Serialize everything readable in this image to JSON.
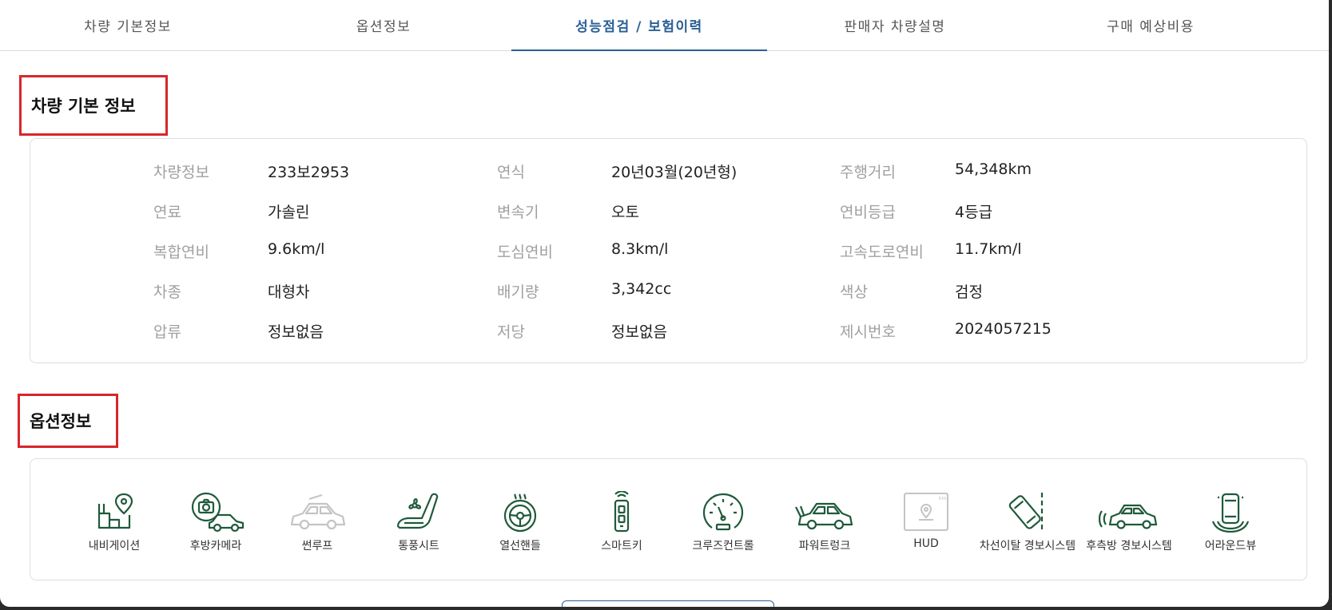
{
  "tabs": [
    {
      "label": "차량 기본정보",
      "active": false
    },
    {
      "label": "옵션정보",
      "active": false
    },
    {
      "label": "성능점검 / 보험이력",
      "active": true
    },
    {
      "label": "판매자 차량설명",
      "active": false
    },
    {
      "label": "구매 예상비용",
      "active": false
    }
  ],
  "basic_info": {
    "title": "차량 기본 정보",
    "rows": [
      [
        {
          "label": "차량정보",
          "value": "233보2953"
        },
        {
          "label": "연식",
          "value": "20년03월(20년형)"
        },
        {
          "label": "주행거리",
          "value": "54,348km"
        }
      ],
      [
        {
          "label": "연료",
          "value": "가솔린"
        },
        {
          "label": "변속기",
          "value": "오토"
        },
        {
          "label": "연비등급",
          "value": "4등급"
        }
      ],
      [
        {
          "label": "복합연비",
          "value": "9.6km/l"
        },
        {
          "label": "도심연비",
          "value": "8.3km/l"
        },
        {
          "label": "고속도로연비",
          "value": "11.7km/l"
        }
      ],
      [
        {
          "label": "차종",
          "value": "대형차"
        },
        {
          "label": "배기량",
          "value": "3,342cc"
        },
        {
          "label": "색상",
          "value": "검정"
        }
      ],
      [
        {
          "label": "압류",
          "value": "정보없음"
        },
        {
          "label": "저당",
          "value": "정보없음"
        },
        {
          "label": "제시번호",
          "value": "2024057215"
        }
      ]
    ]
  },
  "options": {
    "title": "옵션정보",
    "items": [
      {
        "label": "내비게이션",
        "icon": "navigation-icon",
        "enabled": true
      },
      {
        "label": "후방카메라",
        "icon": "rear-camera-icon",
        "enabled": true
      },
      {
        "label": "썬루프",
        "icon": "sunroof-icon",
        "enabled": false
      },
      {
        "label": "통풍시트",
        "icon": "ventilated-seat-icon",
        "enabled": true
      },
      {
        "label": "열선핸들",
        "icon": "heated-steering-icon",
        "enabled": true
      },
      {
        "label": "스마트키",
        "icon": "smart-key-icon",
        "enabled": true
      },
      {
        "label": "크루즈컨트롤",
        "icon": "cruise-control-icon",
        "enabled": true
      },
      {
        "label": "파워트렁크",
        "icon": "power-trunk-icon",
        "enabled": true
      },
      {
        "label": "HUD",
        "icon": "hud-icon",
        "enabled": false
      },
      {
        "label": "차선이탈 경보시스템",
        "icon": "lane-departure-icon",
        "enabled": true
      },
      {
        "label": "후측방 경보시스템",
        "icon": "blind-spot-icon",
        "enabled": true
      },
      {
        "label": "어라운드뷰",
        "icon": "around-view-icon",
        "enabled": true
      }
    ]
  },
  "colors": {
    "active_tab": "#2a5f96",
    "highlight_box": "#d8262c",
    "icon_enabled": "#1f5a3a",
    "icon_disabled": "#c4c4c4"
  }
}
